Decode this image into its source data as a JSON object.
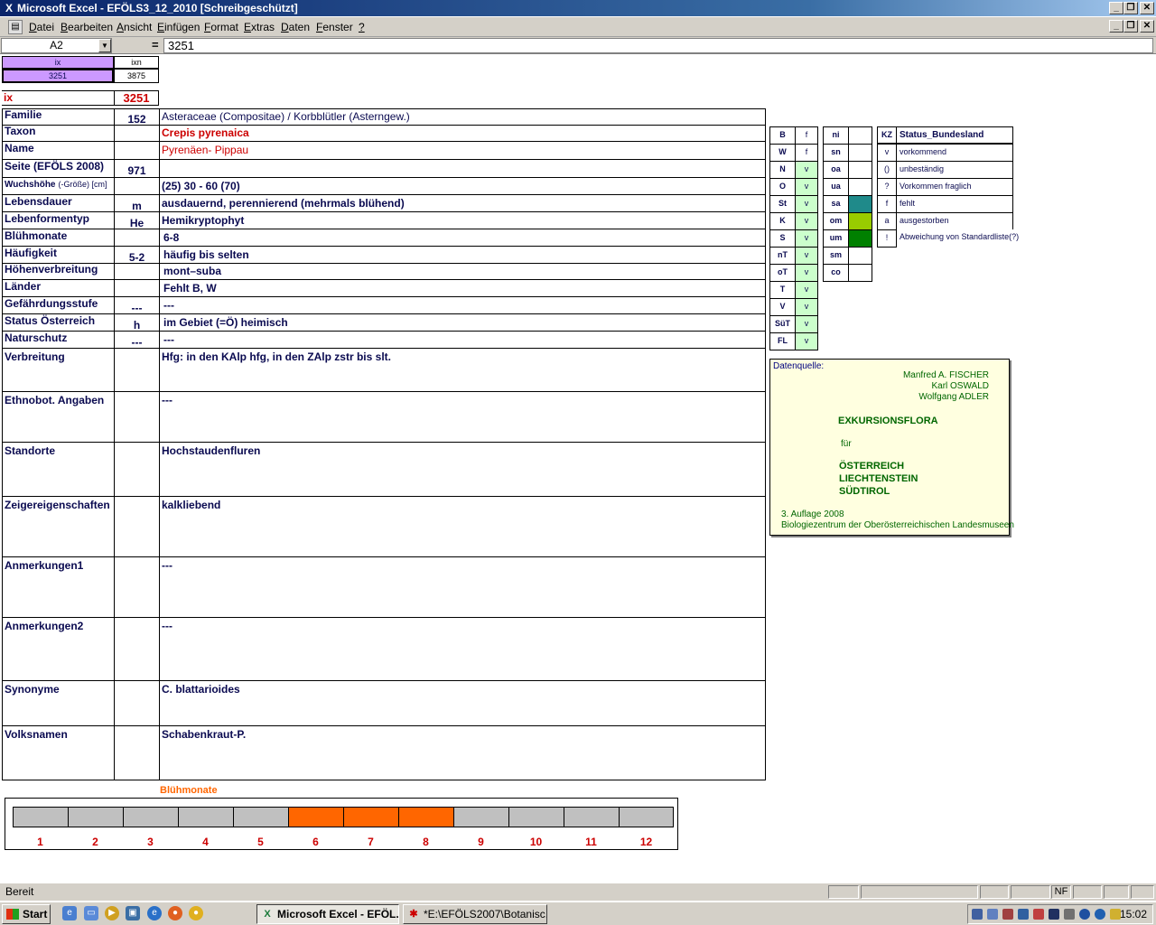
{
  "window": {
    "title": "Microsoft Excel - EFÖLS3_12_2010  [Schreibgeschützt]"
  },
  "menu": [
    "Datei",
    "Bearbeiten",
    "Ansicht",
    "Einfügen",
    "Format",
    "Extras",
    "Daten",
    "Fenster",
    "?"
  ],
  "formula_bar": {
    "name_box": "A2",
    "equals": "=",
    "value": "3251"
  },
  "header_cells": {
    "ix_label": "ix",
    "ixn_label": "ixn",
    "ix_value": "3251",
    "ixn_value": "3875",
    "ix_big_label": "ix",
    "ix_big_value": "3251"
  },
  "rows": [
    {
      "label": "Familie",
      "code": "152",
      "value": "Asteraceae (Compositae)  /  Korbblütler (Asterngew.)"
    },
    {
      "label": "Taxon",
      "code": "",
      "value": "Crepis pyrenaica"
    },
    {
      "label": "Name",
      "code": "",
      "value": "Pyrenäen- Pippau"
    },
    {
      "label": "Seite (EFÖLS 2008)",
      "code": "971",
      "value": ""
    },
    {
      "label": "Wuchshöhe",
      "label_suffix": "(-Größe) [cm]",
      "code": "",
      "value": "(25) 30 - 60 (70)"
    },
    {
      "label": "Lebensdauer",
      "code": "m",
      "value": "ausdauernd, perennierend (mehrmals blühend)"
    },
    {
      "label": "Lebenformentyp",
      "code": "He",
      "value": "Hemikryptophyt"
    },
    {
      "label": "Blühmonate",
      "code": "",
      "value": "6-8"
    },
    {
      "label": "Häufigkeit",
      "code": "5-2",
      "value": "häufig bis selten"
    },
    {
      "label": "Höhenverbreitung",
      "code": "",
      "value": "mont–suba"
    },
    {
      "label": "Länder",
      "code": "",
      "value": "Fehlt B, W"
    },
    {
      "label": "Gefährdungsstufe",
      "code": "---",
      "value": "---"
    },
    {
      "label": "Status Österreich",
      "code": "h",
      "value": "im Gebiet (=Ö) heimisch"
    },
    {
      "label": "Naturschutz",
      "code": "---",
      "value": "---"
    }
  ],
  "big_rows": [
    {
      "label": "Verbreitung",
      "value": "Hfg:  in den KAlp hfg, in den ZAlp zstr bis slt."
    },
    {
      "label": "Ethnobot. Angaben",
      "value": "---"
    },
    {
      "label": "Standorte",
      "value": "Hochstaudenfluren"
    },
    {
      "label": "Zeigereigenschaften",
      "value": "kalkliebend"
    },
    {
      "label": "Anmerkungen1",
      "value": "---"
    },
    {
      "label": "Anmerkungen2",
      "value": "---"
    },
    {
      "label": "Synonyme",
      "value": "C. blattarioides"
    },
    {
      "label": "Volksnamen",
      "value": "Schabenkraut-P."
    }
  ],
  "states": [
    {
      "code": "B",
      "status": "f"
    },
    {
      "code": "W",
      "status": "f"
    },
    {
      "code": "N",
      "status": "v"
    },
    {
      "code": "O",
      "status": "v"
    },
    {
      "code": "St",
      "status": "v"
    },
    {
      "code": "K",
      "status": "v"
    },
    {
      "code": "S",
      "status": "v"
    },
    {
      "code": "nT",
      "status": "v"
    },
    {
      "code": "oT",
      "status": "v"
    },
    {
      "code": "T",
      "status": "v"
    },
    {
      "code": "V",
      "status": "v"
    },
    {
      "code": "SüT",
      "status": "v"
    },
    {
      "code": "FL",
      "status": "v"
    }
  ],
  "zones": [
    {
      "code": "ni",
      "color": ""
    },
    {
      "code": "sn",
      "color": ""
    },
    {
      "code": "oa",
      "color": ""
    },
    {
      "code": "ua",
      "color": ""
    },
    {
      "code": "sa",
      "color": "#1f8a8a"
    },
    {
      "code": "om",
      "color": "#99cc00"
    },
    {
      "code": "um",
      "color": "#008000"
    },
    {
      "code": "sm",
      "color": ""
    },
    {
      "code": "co",
      "color": ""
    }
  ],
  "legend": {
    "header_kz": "KZ",
    "header_status": "Status_Bundesland",
    "items": [
      {
        "kz": "v",
        "text": "vorkommend"
      },
      {
        "kz": "()",
        "text": "unbeständig"
      },
      {
        "kz": "?",
        "text": "Vorkommen fraglich"
      },
      {
        "kz": "f",
        "text": "fehlt"
      },
      {
        "kz": "a",
        "text": "ausgestorben"
      },
      {
        "kz": "!",
        "text": "Abweichung von Standardliste(?)"
      }
    ]
  },
  "source": {
    "label": "Datenquelle:",
    "author1": "Manfred A. FISCHER",
    "author2": "Karl OSWALD",
    "author3": "Wolfgang ADLER",
    "book": "EXKURSIONSFLORA",
    "fuer": "für",
    "country1": "ÖSTERREICH",
    "country2": "LIECHTENSTEIN",
    "country3": "SÜDTIROL",
    "edition": "3. Auflage 2008",
    "publisher": "Biologiezentrum der Oberösterreichischen Landesmuseen"
  },
  "months_chart": {
    "title": "Blühmonate",
    "months": [
      "1",
      "2",
      "3",
      "4",
      "5",
      "6",
      "7",
      "8",
      "9",
      "10",
      "11",
      "12"
    ],
    "active": [
      6,
      7,
      8
    ],
    "active_color": "#ff6600",
    "inactive_color": "#c0c0c0"
  },
  "status_bar": {
    "text": "Bereit",
    "nf": "NF"
  },
  "taskbar": {
    "start": "Start",
    "tasks": [
      {
        "label": "Microsoft Excel - EFÖL...",
        "active": true
      },
      {
        "label": "*E:\\EFÖLS2007\\Botanisc...",
        "active": false
      }
    ],
    "clock": "15:02"
  }
}
